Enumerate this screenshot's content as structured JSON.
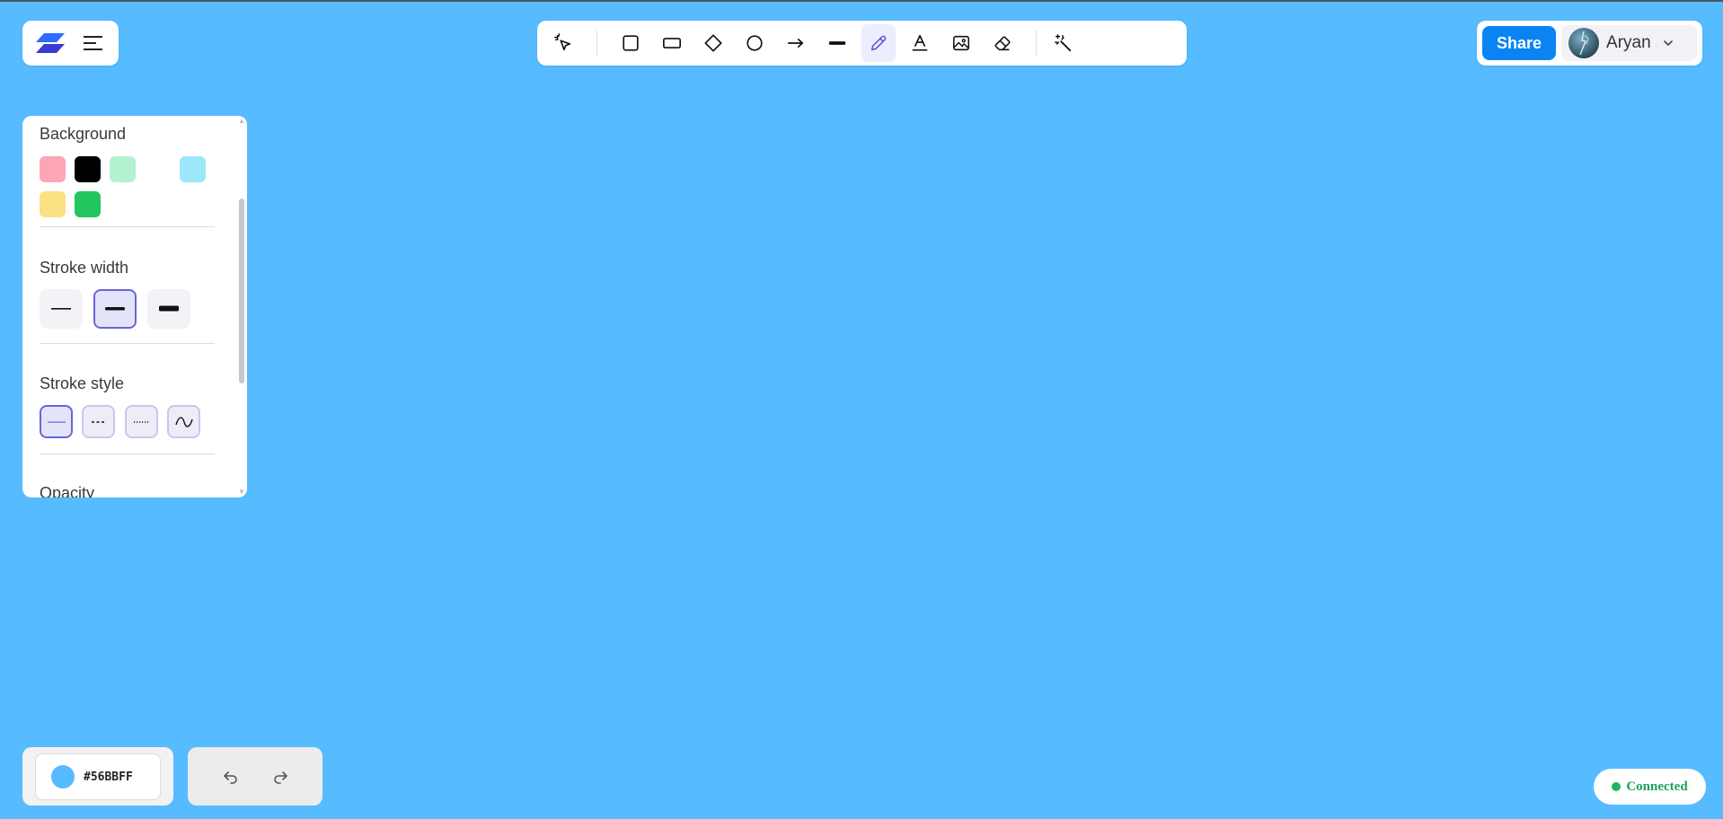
{
  "app": {
    "background_color": "#56BBFF",
    "menu_icon": "hamburger-menu-icon",
    "logo_icon": "app-logo-icon"
  },
  "toolbar": {
    "tools": [
      {
        "name": "select",
        "icon": "cursor-sparkle-icon",
        "active": false
      },
      {
        "name": "rectangle",
        "icon": "square-icon",
        "active": false
      },
      {
        "name": "wide-rectangle",
        "icon": "rectangle-icon",
        "active": false
      },
      {
        "name": "diamond",
        "icon": "diamond-icon",
        "active": false
      },
      {
        "name": "ellipse",
        "icon": "circle-icon",
        "active": false
      },
      {
        "name": "arrow",
        "icon": "arrow-right-icon",
        "active": false
      },
      {
        "name": "line",
        "icon": "line-icon",
        "active": false
      },
      {
        "name": "pencil",
        "icon": "pencil-icon",
        "active": true
      },
      {
        "name": "text",
        "icon": "text-icon",
        "active": false
      },
      {
        "name": "image",
        "icon": "image-icon",
        "active": false
      },
      {
        "name": "eraser",
        "icon": "eraser-icon",
        "active": false
      },
      {
        "name": "magic",
        "icon": "magic-wand-icon",
        "active": false
      }
    ]
  },
  "header": {
    "share_label": "Share",
    "user_name": "Aryan"
  },
  "panel": {
    "background_label": "Background",
    "background_colors": [
      "#FCA5B5",
      "#000000",
      "#B3F2CF",
      "#FFFFFF",
      "#9CE8FA",
      "#FCE184",
      "#22C55E"
    ],
    "stroke_width_label": "Stroke width",
    "stroke_width_selected": 1,
    "stroke_style_label": "Stroke style",
    "stroke_style_selected": 0,
    "opacity_label": "Opacity"
  },
  "footer": {
    "current_color": "#56BBFF",
    "current_color_label": "#56BBFF",
    "status": "Connected"
  }
}
